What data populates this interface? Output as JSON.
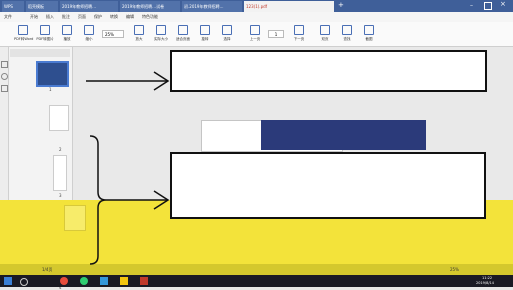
{
  "tabs": [
    {
      "label": "WPS"
    },
    {
      "label": "稻壳模板"
    },
    {
      "label": "2019年教师招聘…"
    },
    {
      "label": "2019年教师招聘…试卷"
    },
    {
      "label": "初.2019年教师招聘…"
    },
    {
      "label": "123(1).pdf"
    }
  ],
  "menu": [
    "文件",
    "开始",
    "插入",
    "批注",
    "页面",
    "保护",
    "转换",
    "编辑",
    "特色功能"
  ],
  "toolbar": [
    {
      "label": "PDF转Word"
    },
    {
      "label": "PDF转图片"
    },
    {
      "label": "播放"
    },
    {
      "label": "缩小"
    },
    {
      "label": "放大"
    },
    {
      "label": "实际大小"
    },
    {
      "label": "适合页面"
    },
    {
      "label": "旋转"
    },
    {
      "label": "选择"
    },
    {
      "label": "上一页"
    },
    {
      "label": "下一页"
    },
    {
      "label": "双页"
    },
    {
      "label": "查找"
    },
    {
      "label": "截图"
    }
  ],
  "zoom": "25%",
  "page_input": "1",
  "thumbnail_pages": [
    "1",
    "2",
    "3",
    "4"
  ],
  "status": {
    "page": "1/4页",
    "zoom_level": "25%"
  },
  "taskbar_clock": {
    "time": "11:22",
    "date": "2019/8/14"
  },
  "colors": {
    "tabbar": "#3f5f99",
    "active_tab_text": "#c0392b",
    "yellow_overlay": "#f3e33a",
    "taskbar": "#1a1a24"
  }
}
